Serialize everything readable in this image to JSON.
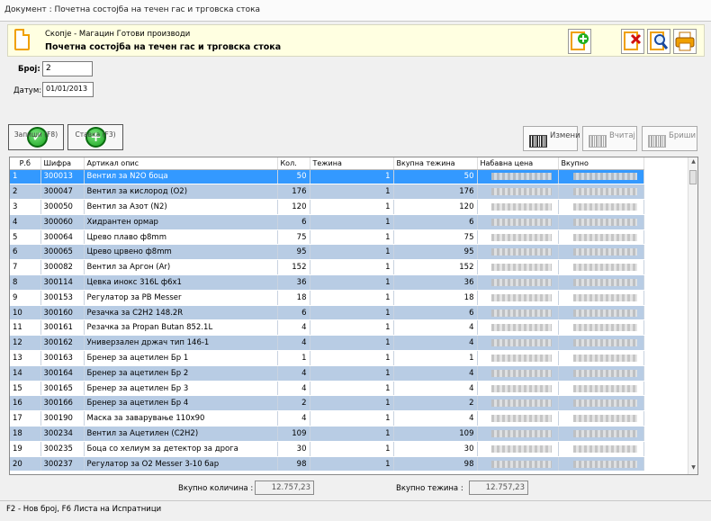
{
  "window": {
    "title": "Документ : Почетна состојба на течен гас и трговска стока"
  },
  "header": {
    "subtitle": "Скопје - Магацин Готови производи",
    "title": "Почетна состојба на течен гас и трговска стока",
    "icons": [
      "new-document-icon",
      "delete-document-icon",
      "search-icon",
      "print-icon"
    ]
  },
  "form": {
    "number_label": "Број:",
    "number_value": "2",
    "date_label": "Датум:",
    "date_value": "01/01/2013"
  },
  "buttons": {
    "save": "Запиши (F8)",
    "item": "Ставка (F3)",
    "edit": "Измени",
    "load": "Вчитај",
    "delete": "Бриши"
  },
  "table": {
    "columns": [
      "Р.б",
      "Шифра",
      "Артикал опис",
      "Кол.",
      "Тежина",
      "Вкупна тежина",
      "Набавна цена",
      "Вкупно"
    ],
    "rows": [
      [
        "1",
        "300013",
        "Вентил за N2O боца",
        "50",
        "1",
        "50"
      ],
      [
        "2",
        "300047",
        "Вентил за кислород (O2)",
        "176",
        "1",
        "176"
      ],
      [
        "3",
        "300050",
        "Вентил за Азот (N2)",
        "120",
        "1",
        "120"
      ],
      [
        "4",
        "300060",
        "Хидрантен ормар",
        "6",
        "1",
        "6"
      ],
      [
        "5",
        "300064",
        "Црево плаво ф8mm",
        "75",
        "1",
        "75"
      ],
      [
        "6",
        "300065",
        "Црево црвено ф8mm",
        "95",
        "1",
        "95"
      ],
      [
        "7",
        "300082",
        "Вентил за Аргон (Ar)",
        "152",
        "1",
        "152"
      ],
      [
        "8",
        "300114",
        "Цевка инокс 316L ф6х1",
        "36",
        "1",
        "36"
      ],
      [
        "9",
        "300153",
        "Регулатор за PB Messer",
        "18",
        "1",
        "18"
      ],
      [
        "10",
        "300160",
        "Резачка за C2H2 148.2R",
        "6",
        "1",
        "6"
      ],
      [
        "11",
        "300161",
        "Резачка за Propan Butan 852.1L",
        "4",
        "1",
        "4"
      ],
      [
        "12",
        "300162",
        "Универзален држач тип 146-1",
        "4",
        "1",
        "4"
      ],
      [
        "13",
        "300163",
        "Бренер за ацетилен Бр 1",
        "1",
        "1",
        "1"
      ],
      [
        "14",
        "300164",
        "Бренер за ацетилен Бр 2",
        "4",
        "1",
        "4"
      ],
      [
        "15",
        "300165",
        "Бренер за ацетилен Бр 3",
        "4",
        "1",
        "4"
      ],
      [
        "16",
        "300166",
        "Бренер за ацетилен Бр 4",
        "2",
        "1",
        "2"
      ],
      [
        "17",
        "300190",
        "Маска за заварување 110х90",
        "4",
        "1",
        "4"
      ],
      [
        "18",
        "300234",
        "Вентил за Ацетилен (C2H2)",
        "109",
        "1",
        "109"
      ],
      [
        "19",
        "300235",
        "Боца со хелиум за детектор за дрога",
        "30",
        "1",
        "30"
      ],
      [
        "20",
        "300237",
        "Регулатор за O2 Messer 3-10 бар",
        "98",
        "1",
        "98"
      ]
    ]
  },
  "totals": {
    "qty_label": "Вкупно количина :",
    "qty_value": "12.757,23",
    "weight_label": "Вкупно тежина :",
    "weight_value": "12.757,23"
  },
  "status": "F2 - Нов број, F6 Листа на Испратници"
}
